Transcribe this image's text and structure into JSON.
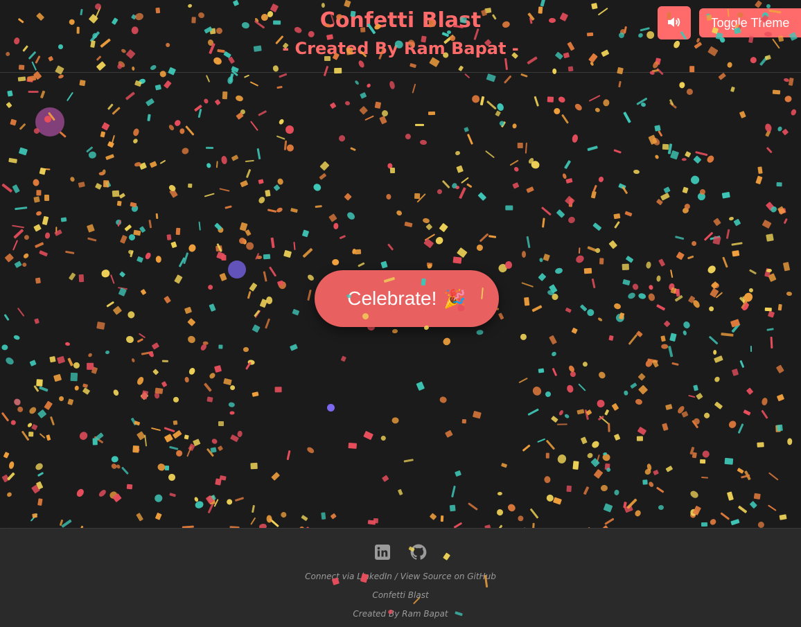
{
  "header": {
    "title": "Confetti Blast",
    "subtitle": "- Created By Ram Bapat -",
    "sound_icon": "speaker-volume-icon",
    "theme_button_label": "Toggle Theme"
  },
  "main": {
    "celebrate_label": "Celebrate!",
    "celebrate_emoji": "🎉"
  },
  "footer": {
    "icons": [
      "linkedin-icon",
      "github-icon"
    ],
    "linkedin_link": "Connect via LinkedIn",
    "separator": "/",
    "source_link": "View Source on GitHub",
    "app_name": "Confetti Blast",
    "credit": "Created By Ram Bapat"
  },
  "colors": {
    "background": "#1b1b1b",
    "footer_background": "#2a2a2a",
    "accent": "#ff6b6b",
    "button": "#e86060",
    "confetti": [
      "#3ec6b6",
      "#e84e5c",
      "#f2a03d",
      "#efd257",
      "#e07a3c"
    ],
    "orbs": [
      "#8e4585",
      "#6a5acd",
      "#7b68ee"
    ]
  }
}
